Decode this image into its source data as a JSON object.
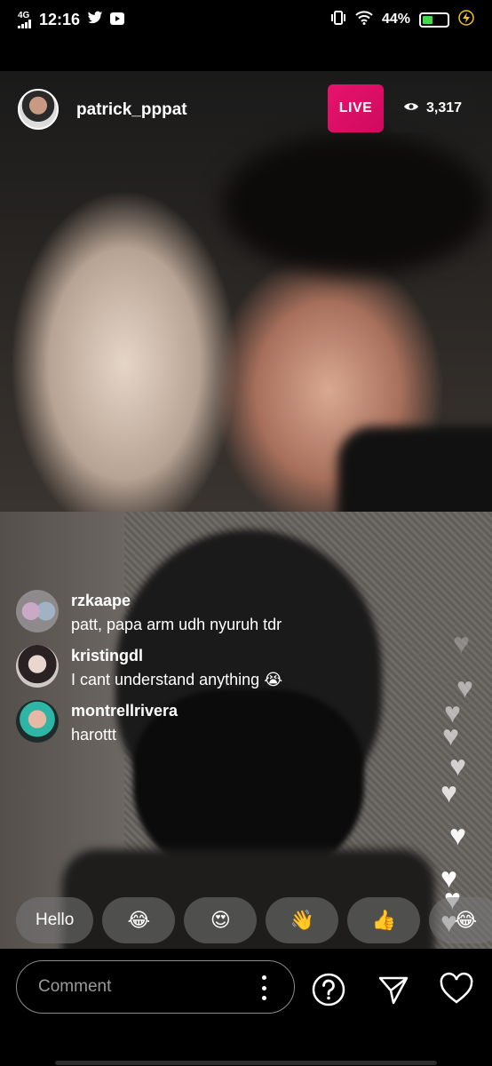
{
  "status_bar": {
    "network": "4G",
    "time": "12:16",
    "battery_percent": "44%",
    "battery_level": 0.44,
    "icons": [
      "signal-icon",
      "twitter-icon",
      "youtube-icon",
      "vibrate-icon",
      "wifi-icon",
      "battery-icon",
      "charging-icon"
    ]
  },
  "live": {
    "username": "patrick_pppat",
    "badge": "LIVE",
    "viewers": "3,317",
    "badge_color": "#e1126b"
  },
  "comments": [
    {
      "user": "rzkaape",
      "text": "patt, papa arm udh nyuruh tdr",
      "avatar_color": "#b2a6b4"
    },
    {
      "user": "kristingdl",
      "text": "I cant understand anything 😭",
      "avatar_color": "#d8d2cf"
    },
    {
      "user": "montrellrivera",
      "text": "harottt",
      "avatar_color": "#2fb5a6"
    }
  ],
  "quick_replies": [
    "Hello",
    "😂",
    "😍",
    "👋",
    "👍",
    "😂"
  ],
  "bottom_bar": {
    "comment_placeholder": "Comment",
    "icons": [
      "more-options-icon",
      "question-icon",
      "send-icon",
      "heart-icon"
    ]
  },
  "colors": {
    "accent_live": "#e1126b",
    "battery_green": "#3ddc4b",
    "charging_bolt": "#f5c518"
  }
}
